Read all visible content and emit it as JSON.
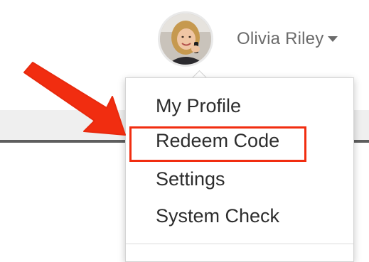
{
  "user": {
    "name": "Olivia Riley",
    "avatar_icon": "avatar-photo",
    "caret_icon": "caret-down-icon"
  },
  "dropdown": {
    "items": [
      {
        "label": "My Profile"
      },
      {
        "label": "Redeem Code"
      },
      {
        "label": "Settings"
      },
      {
        "label": "System Check"
      }
    ]
  },
  "annotation": {
    "highlighted_item": "Redeem Code",
    "color": "#f12d10"
  }
}
